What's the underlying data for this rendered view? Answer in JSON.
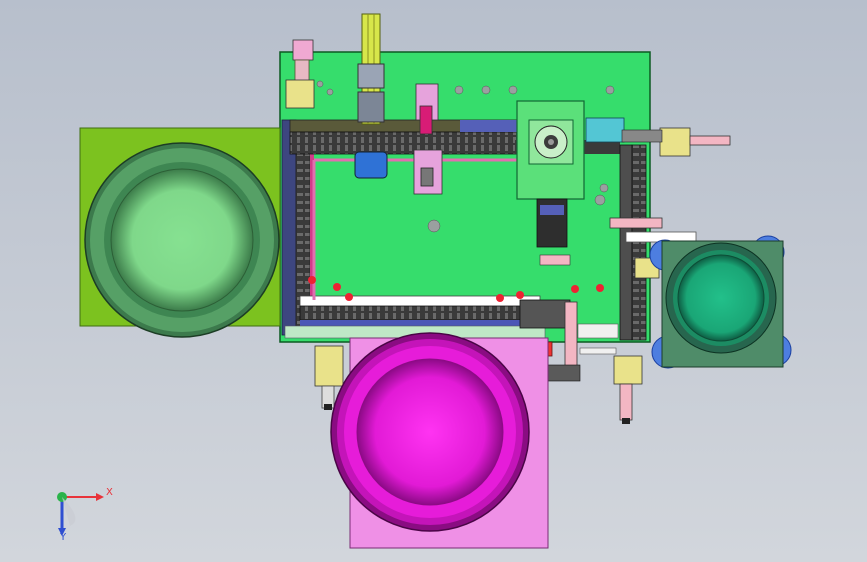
{
  "triad": {
    "x_label": "X",
    "y_label": "Y",
    "x_color": "#e8333a",
    "y_color": "#2ab34a",
    "z_color": "#2f4fd1"
  },
  "colors": {
    "base_plate": "#33dd6a",
    "left_bowl_base": "#7cc21e",
    "pink_bowl_base": "#ee8fe6",
    "pink_bowl": "#e018d3",
    "right_bowl_base": "#4f8b69",
    "conveyor": "#4c4c4c",
    "rail": "#4b56b6"
  }
}
